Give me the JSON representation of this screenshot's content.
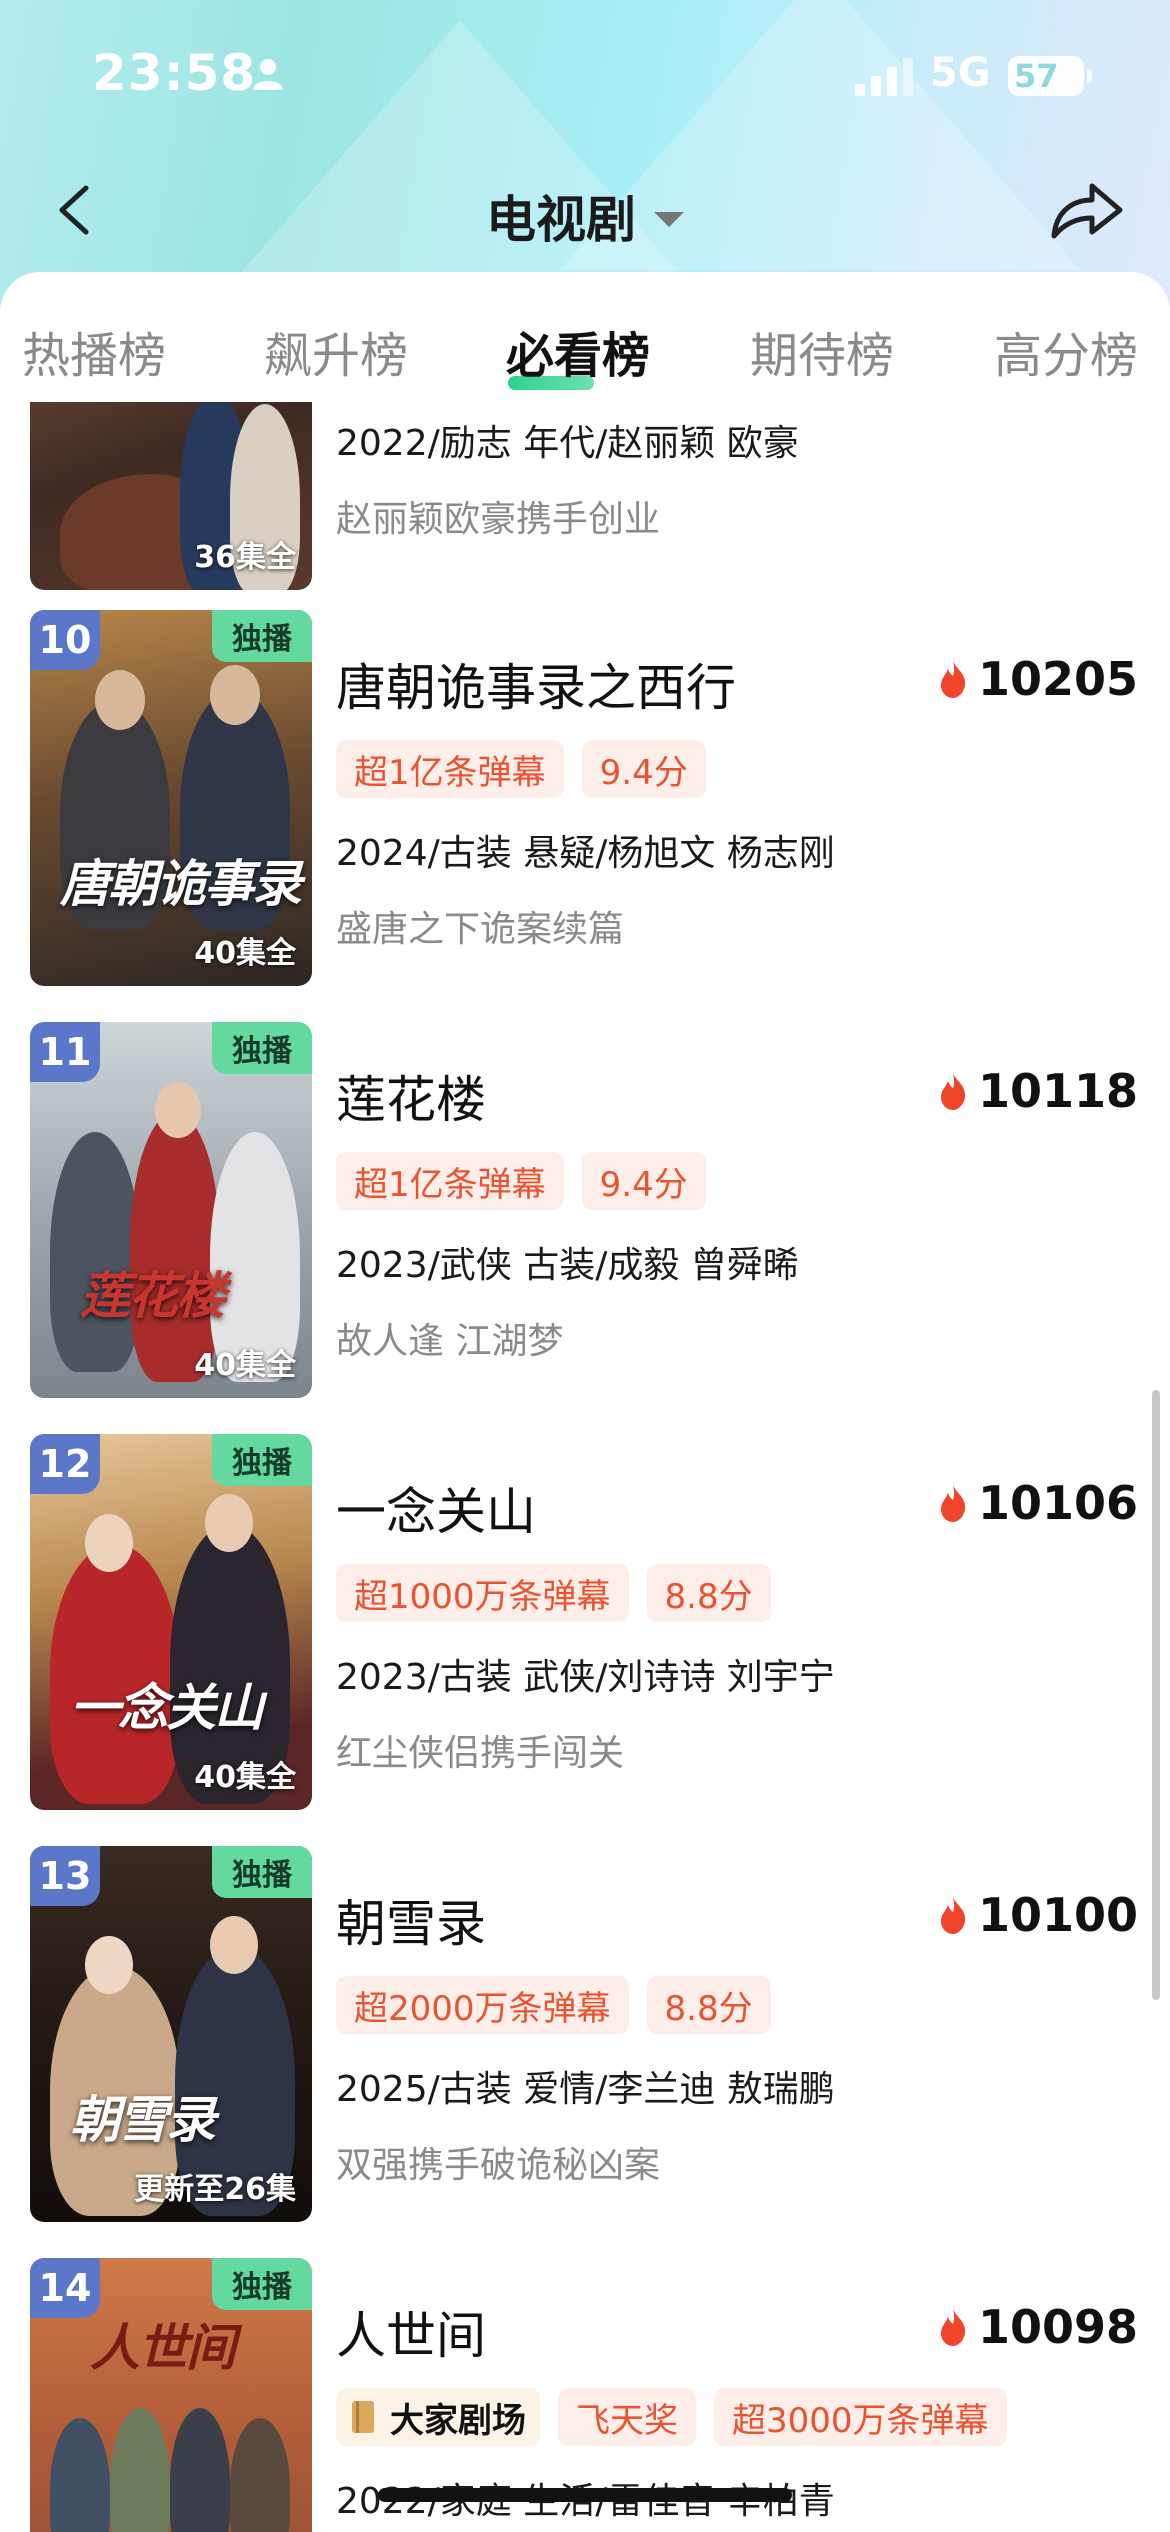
{
  "status_bar": {
    "time": "23:58",
    "network": "5G",
    "battery": "57"
  },
  "nav": {
    "title": "电视剧"
  },
  "tabs": [
    {
      "label": "热播榜",
      "active": false
    },
    {
      "label": "飙升榜",
      "active": false
    },
    {
      "label": "必看榜",
      "active": true
    },
    {
      "label": "期待榜",
      "active": false
    },
    {
      "label": "高分榜",
      "active": false
    }
  ],
  "items": [
    {
      "rank": "",
      "exclusive": "",
      "episodes": "36集全",
      "title": "",
      "heat": "",
      "tags": [],
      "meta": "2022/励志 年代/赵丽颖 欧豪",
      "desc": "赵丽颖欧豪携手创业"
    },
    {
      "rank": "10",
      "exclusive": "独播",
      "episodes": "40集全",
      "title": "唐朝诡事录之西行",
      "heat": "10205",
      "tags": [
        "超1亿条弹幕",
        "9.4分"
      ],
      "meta": "2024/古装 悬疑/杨旭文 杨志刚",
      "desc": "盛唐之下诡案续篇"
    },
    {
      "rank": "11",
      "exclusive": "独播",
      "episodes": "40集全",
      "title": "莲花楼",
      "heat": "10118",
      "tags": [
        "超1亿条弹幕",
        "9.4分"
      ],
      "meta": "2023/武侠 古装/成毅 曾舜晞",
      "desc": "故人逢 江湖梦"
    },
    {
      "rank": "12",
      "exclusive": "独播",
      "episodes": "40集全",
      "title": "一念关山",
      "heat": "10106",
      "tags": [
        "超1000万条弹幕",
        "8.8分"
      ],
      "meta": "2023/古装 武侠/刘诗诗 刘宇宁",
      "desc": "红尘侠侣携手闯关"
    },
    {
      "rank": "13",
      "exclusive": "独播",
      "episodes": "更新至26集",
      "title": "朝雪录",
      "heat": "10100",
      "tags": [
        "超2000万条弹幕",
        "8.8分"
      ],
      "meta": "2025/古装 爱情/李兰迪 敖瑞鹏",
      "desc": "双强携手破诡秘凶案"
    },
    {
      "rank": "14",
      "exclusive": "独播",
      "episodes": "",
      "title": "人世间",
      "heat": "10098",
      "badge": "大家剧场",
      "tags": [
        "飞天奖",
        "超3000万条弹幕"
      ],
      "meta": "2022/家庭 生活/雷佳音 辛柏青",
      "desc": ""
    }
  ],
  "poster_titles": {
    "item1": "唐朝诡事录",
    "item2": "莲花楼",
    "item3": "一念关山",
    "item4": "朝雪录",
    "item5": "人世间"
  },
  "colors": {
    "accent_green": "#2fd18a",
    "rank_badge": "#5b77c9",
    "exclusive_badge": "#63d9a0",
    "tag_text": "#e9532f",
    "tag_bg": "#fdeeea",
    "flame": "#f0442b"
  }
}
